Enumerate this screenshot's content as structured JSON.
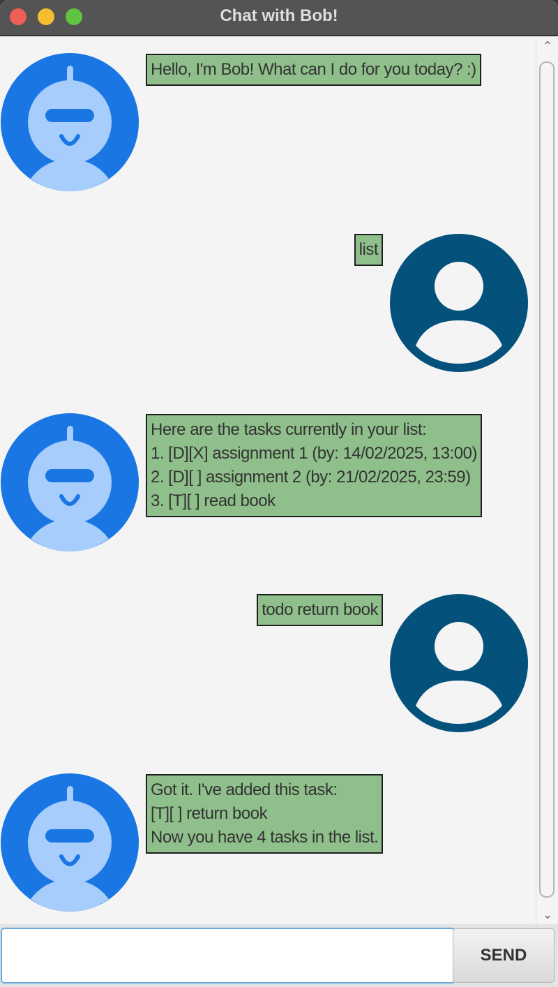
{
  "window": {
    "title": "Chat with Bob!"
  },
  "messages": [
    {
      "sender": "bot",
      "text": "Hello, I'm Bob! What can I do for you today? :)"
    },
    {
      "sender": "user",
      "text": "list"
    },
    {
      "sender": "bot",
      "text": "Here are the tasks currently in your list:\n1. [D][X] assignment 1 (by: 14/02/2025, 13:00)\n2. [D][ ] assignment 2 (by: 21/02/2025, 23:59)\n3. [T][ ] read book"
    },
    {
      "sender": "user",
      "text": "todo return book"
    },
    {
      "sender": "bot",
      "text": "Got it. I've added this task:\n[T][ ] return book\nNow you have 4 tasks in the list."
    }
  ],
  "input": {
    "value": "",
    "send_label": "SEND"
  },
  "colors": {
    "bubble": "#8fbf8b",
    "bot_avatar_bg": "#1a76e3",
    "bot_avatar_fg": "#a6cdfb",
    "user_avatar_bg": "#04527b",
    "user_avatar_fg": "#f4f4f4"
  },
  "icons": {
    "bot": "robot-avatar-icon",
    "user": "user-avatar-icon"
  }
}
